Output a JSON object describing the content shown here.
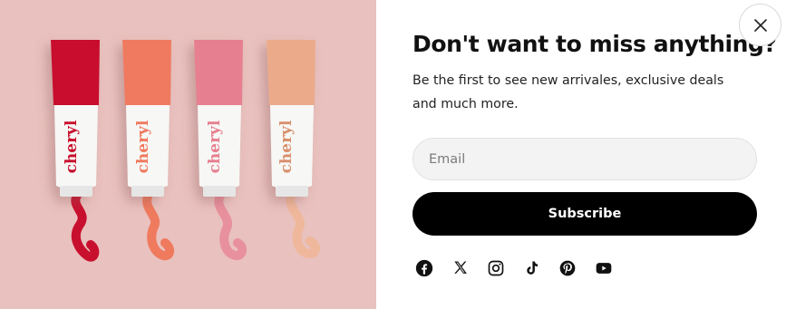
{
  "popup": {
    "title": "Don't want to miss anything?",
    "description": "Be the first to see new arrivales, exclusive deals and much more.",
    "email": {
      "placeholder": "Email",
      "value": ""
    },
    "subscribe_label": "Subscribe",
    "close_icon": "close-icon",
    "social": [
      {
        "name": "facebook-icon"
      },
      {
        "name": "x-twitter-icon"
      },
      {
        "name": "instagram-icon"
      },
      {
        "name": "tiktok-icon"
      },
      {
        "name": "pinterest-icon"
      },
      {
        "name": "youtube-icon"
      }
    ]
  },
  "hero": {
    "background": "#e9c1be",
    "tubes": [
      {
        "brand": "cheryl",
        "cap": "#c8102e",
        "label": "#d93b4a"
      },
      {
        "brand": "cheryl",
        "cap": "#ef7a5e",
        "label": "#f0896f"
      },
      {
        "brand": "cheryl",
        "cap": "#e67f8f",
        "label": "#e8909d"
      },
      {
        "brand": "cheryl",
        "cap": "#ebab8b",
        "label": "#efb89c"
      }
    ]
  },
  "colors": {
    "button": "#000000",
    "input_bg": "#f3f3f3",
    "text": "#111111"
  }
}
